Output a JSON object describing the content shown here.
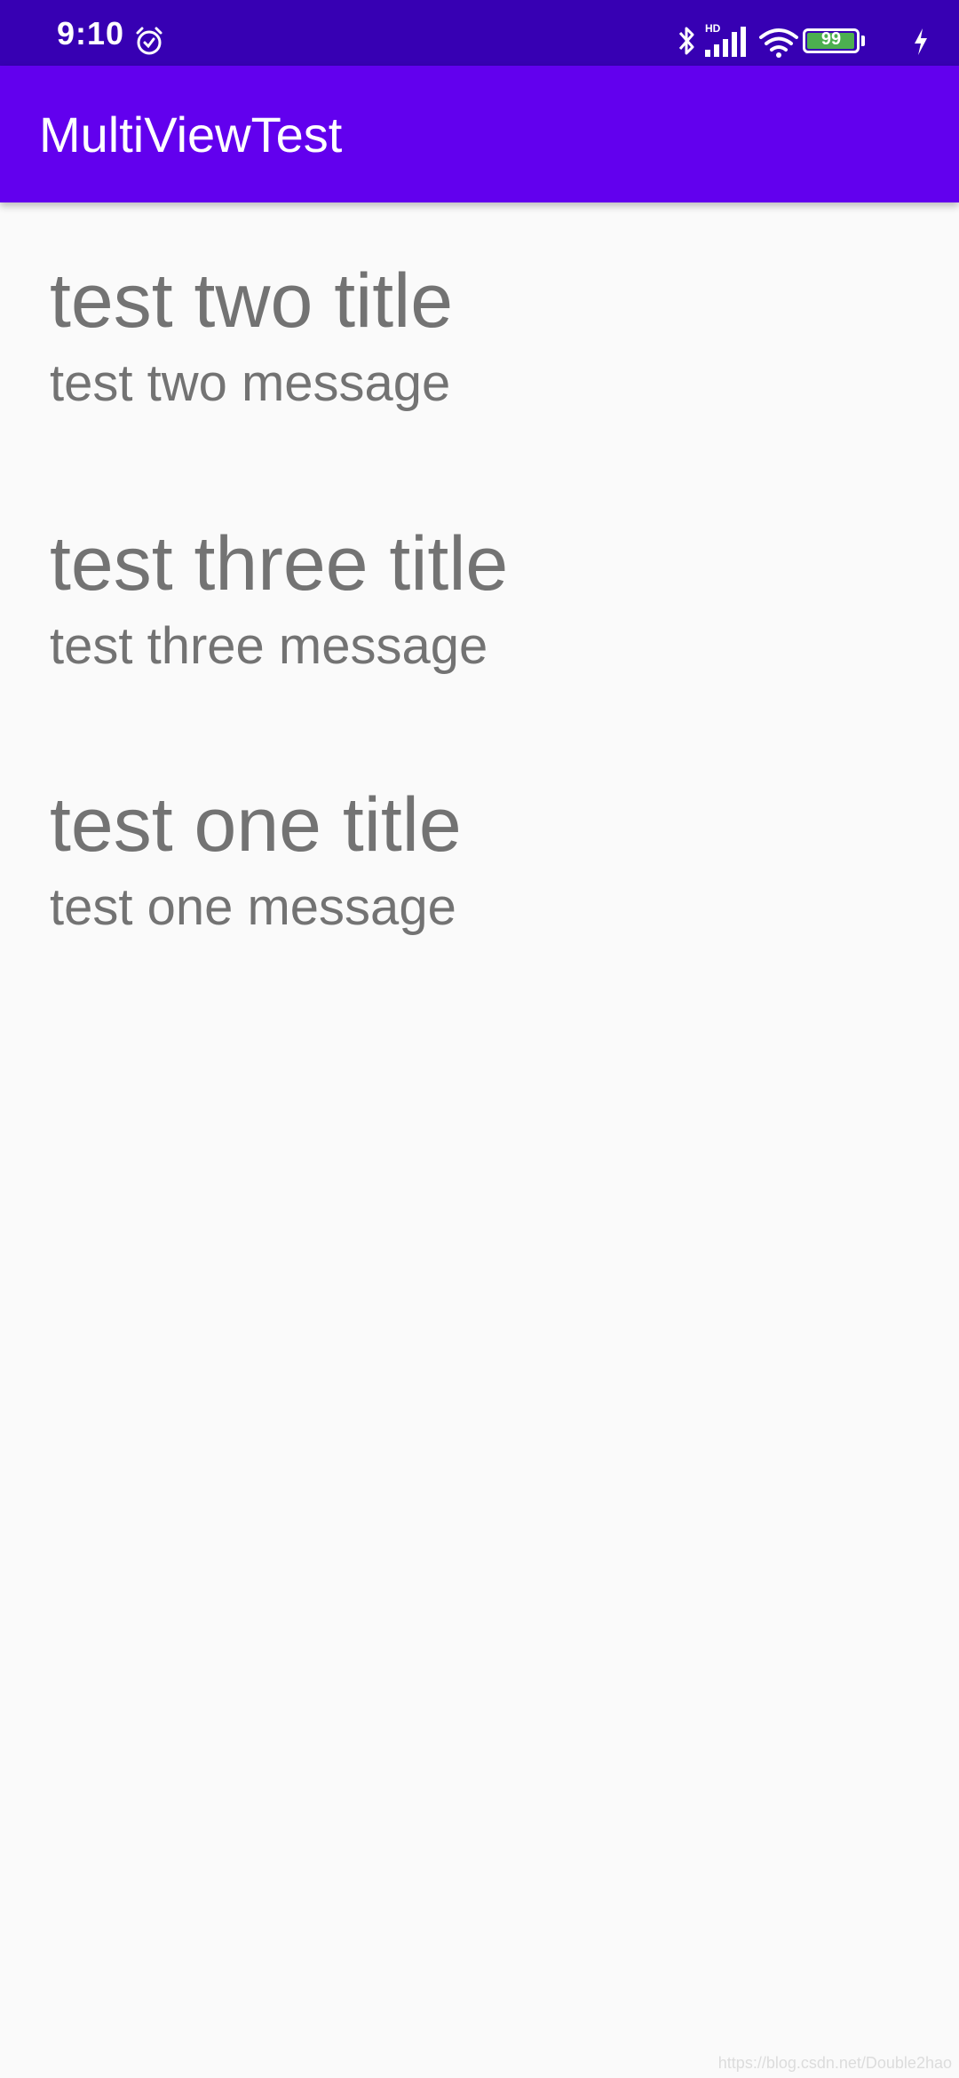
{
  "status_bar": {
    "time": "9:10",
    "battery_level": "99",
    "network_label": "HD",
    "icons": [
      "alarm-icon",
      "bluetooth-icon",
      "signal-icon",
      "wifi-icon",
      "battery-icon",
      "charging-icon"
    ]
  },
  "app_bar": {
    "title": "MultiViewTest",
    "color": "#6200ee",
    "status_color": "#3700b3"
  },
  "list": {
    "items": [
      {
        "title": "test two title",
        "message": "test two message"
      },
      {
        "title": "test three title",
        "message": "test three message"
      },
      {
        "title": "test one title",
        "message": "test one message"
      }
    ]
  },
  "watermark": "https://blog.csdn.net/Double2hao"
}
